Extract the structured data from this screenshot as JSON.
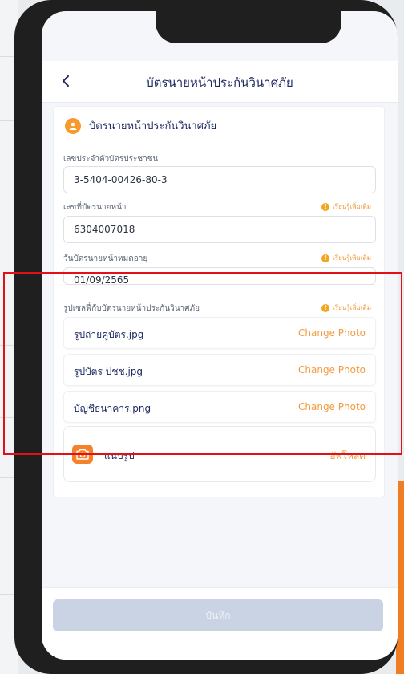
{
  "header": {
    "back_icon": "chevron-left-icon",
    "title": "บัตรนายหน้าประกันวินาศภัย"
  },
  "section": {
    "icon": "person-icon",
    "title": "บัตรนายหน้าประกันวินาศภัย"
  },
  "fields": {
    "citizen_id": {
      "label": "เลขประจำตัวบัตรประชาชน",
      "value": "3-5404-00426-80-3"
    },
    "broker_no": {
      "label": "เลขที่บัตรนายหน้า",
      "more_info": "เรียนรู้เพิ่มเติม",
      "value": "6304007018"
    },
    "expiry": {
      "label": "วันบัตรนายหน้าหมดอายุ",
      "more_info": "เรียนรู้เพิ่มเติม",
      "value": "01/09/2565"
    },
    "documents": {
      "label": "รูปเซลฟี่กับบัตรนายหน้าประกันวินาศภัย",
      "more_info": "เรียนรู้เพิ่มเติม",
      "files": [
        {
          "name": "รูปถ่ายคู่บัตร.jpg",
          "action": "Change Photo"
        },
        {
          "name": "รูปบัตร ปชช.jpg",
          "action": "Change Photo"
        },
        {
          "name": "บัญชีธนาคาร.png",
          "action": "Change Photo"
        }
      ],
      "attach": {
        "icon": "camera-icon",
        "label": "แนบรูป",
        "upload": "อัพโหลด"
      }
    }
  },
  "footer": {
    "save_label": "บันทึก"
  },
  "colors": {
    "accent": "#f39a3e",
    "primary_text": "#1d2a63",
    "highlight": "#e3101b",
    "disabled_button": "#c9d3e3"
  }
}
